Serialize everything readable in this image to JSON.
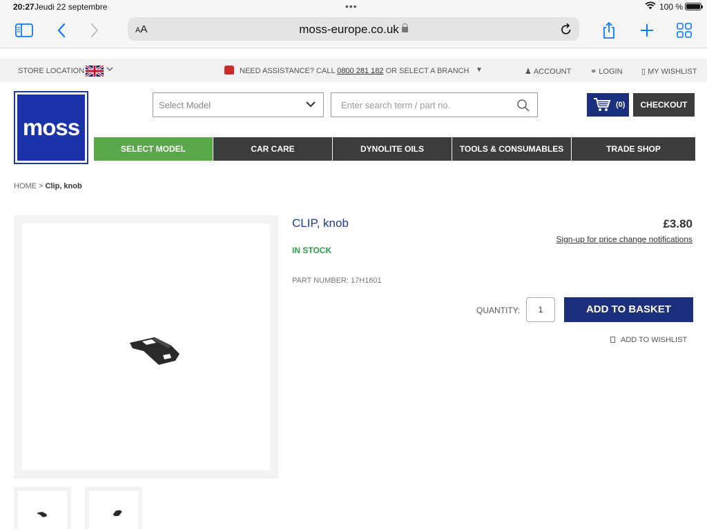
{
  "status_bar": {
    "time": "20:27",
    "date": "Jeudi 22 septembre",
    "battery": "100 %"
  },
  "browser": {
    "aa_small": "A",
    "aa_large": "A",
    "url": "moss-europe.co.uk"
  },
  "utility": {
    "store_location": "STORE LOCATION",
    "assist_prefix": "NEED ASSISTANCE? CALL ",
    "phone": "0800 281 182",
    "assist_suffix": " OR SELECT A BRANCH",
    "account": "ACCOUNT",
    "login": "LOGIN",
    "wishlist": "MY WISHLIST"
  },
  "header": {
    "logo_text": "moss",
    "model_placeholder": "Select Model",
    "search_placeholder": "Enter search term / part no.",
    "cart_count": "(0)",
    "checkout": "CHECKOUT"
  },
  "nav": [
    {
      "label": "SELECT MODEL",
      "active": true
    },
    {
      "label": "CAR CARE"
    },
    {
      "label": "DYNOLITE OILS"
    },
    {
      "label": "TOOLS & CONSUMABLES"
    },
    {
      "label": "TRADE SHOP"
    }
  ],
  "breadcrumb": {
    "home": "HOME",
    "sep": " > ",
    "current": "Clip, knob"
  },
  "product": {
    "title": "CLIP, knob",
    "price": "£3.80",
    "signup": "Sign-up for price change notifications",
    "stock": "IN STOCK",
    "part_number": "PART NUMBER: 17H1601",
    "quantity_label": "QUANTITY:",
    "quantity_value": "1",
    "add_basket": "ADD TO BASKET",
    "add_wishlist": "ADD TO WISHLIST"
  },
  "colors": {
    "brand_blue": "#1b2f7e",
    "nav_active": "#5ba84c",
    "in_stock": "#2d9d4a",
    "title": "#1b3a8c",
    "ios_blue": "#0a7aff"
  }
}
